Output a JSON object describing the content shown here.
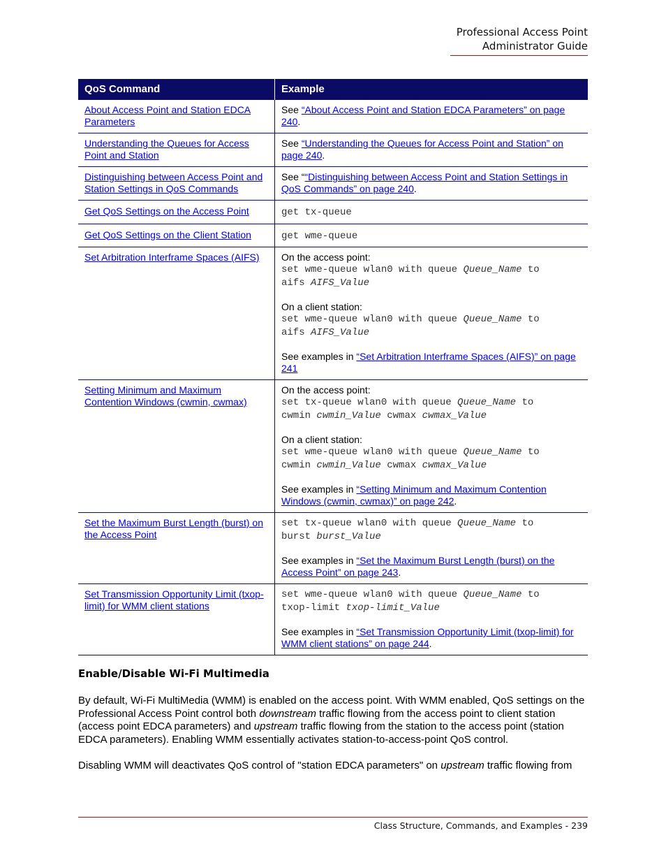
{
  "header": {
    "line1": "Professional Access Point",
    "line2": "Administrator Guide"
  },
  "table": {
    "columns": [
      "QoS Command",
      "Example"
    ],
    "rows": [
      {
        "command": "About Access Point and Station EDCA Parameters",
        "see_prefix": "See ",
        "see_link": "“About Access Point and Station EDCA Parameters” on page 240",
        "see_suffix": "."
      },
      {
        "command": "Understanding the Queues for Access Point and Station",
        "see_prefix": "See ",
        "see_link": "“Understanding the Queues for Access Point and Station” on page 240",
        "see_suffix": "."
      },
      {
        "command": "Distinguishing between Access Point and Station Settings in QoS Commands",
        "see_prefix": "See “",
        "see_link": "“Distinguishing between Access Point and Station Settings in QoS Commands” on page 240",
        "see_suffix": "."
      },
      {
        "command": "Get QoS Settings on the Access Point",
        "code": "get tx-queue"
      },
      {
        "command": "Get QoS Settings on the Client Station",
        "code": "get wme-queue"
      },
      {
        "command": "Set Arbitration Interframe Spaces (AIFS)",
        "ap_label": "On the access point:",
        "ap_code_1a": "set wme-queue wlan0 with queue ",
        "ap_code_1b": "Queue_Name",
        "ap_code_1c": " to",
        "ap_code_2a": "aifs ",
        "ap_code_2b": "AIFS_Value",
        "cs_label": "On a client station:",
        "cs_code_1a": "set wme-queue wlan0 with queue ",
        "cs_code_1b": "Queue_Name",
        "cs_code_1c": " to",
        "cs_code_2a": "aifs ",
        "cs_code_2b": "AIFS_Value",
        "see_prefix": "See examples in ",
        "see_link": "“Set Arbitration Interframe Spaces (AIFS)” on page 241",
        "see_suffix": ""
      },
      {
        "command": "Setting Minimum and Maximum Contention Windows (cwmin, cwmax)",
        "ap_label": "On the access point:",
        "ap_code_1a": "set tx-queue wlan0 with queue ",
        "ap_code_1b": "Queue_Name",
        "ap_code_1c": " to",
        "ap_code_2a": "cwmin ",
        "ap_code_2b": "cwmin_Value",
        "ap_code_2c": " cwmax ",
        "ap_code_2d": "cwmax_Value",
        "cs_label": "On a client station:",
        "cs_code_1a": "set wme-queue wlan0 with queue ",
        "cs_code_1b": "Queue_Name",
        "cs_code_1c": " to",
        "cs_code_2a": "cwmin ",
        "cs_code_2b": "cwmin_Value",
        "cs_code_2c": " cwmax ",
        "cs_code_2d": "cwmax_Value",
        "see_prefix": "See examples in ",
        "see_link": "“Setting Minimum and Maximum Contention Windows (cwmin, cwmax)” on page 242",
        "see_suffix": "."
      },
      {
        "command": "Set the Maximum Burst Length (burst) on the Access Point",
        "code_1a": "set tx-queue wlan0 with queue ",
        "code_1b": "Queue_Name",
        "code_1c": " to",
        "code_2a": "burst ",
        "code_2b": "burst_Value",
        "see_prefix": "See examples in ",
        "see_link": "“Set the Maximum Burst Length (burst) on the Access Point” on page 243",
        "see_suffix": "."
      },
      {
        "command": "Set Transmission Opportunity Limit (txop-limit) for WMM client stations",
        "code_1a": "set wme-queue wlan0 with queue ",
        "code_1b": "Queue_Name",
        "code_1c": " to",
        "code_2a": "txop-limit ",
        "code_2b": "txop-limit_Value",
        "see_prefix": "See examples in ",
        "see_link": "“Set Transmission Opportunity Limit (txop-limit) for WMM client stations” on page 244",
        "see_suffix": "."
      }
    ]
  },
  "section": {
    "title": "Enable/Disable Wi-Fi Multimedia",
    "p1_a": "By default, Wi-Fi MultiMedia (WMM) is enabled on the access point. With WMM enabled, QoS settings on the Professional Access Point control both ",
    "p1_em1": "downstream",
    "p1_b": " traffic flowing from the access point to client station (access point EDCA parameters) and ",
    "p1_em2": "upstream",
    "p1_c": " traffic flowing from the station to the access point (station EDCA parameters). Enabling WMM essentially activates station-to-access-point QoS control.",
    "p2_a": "Disabling WMM will deactivates QoS control of \"station EDCA parameters\" on ",
    "p2_em": "upstream",
    "p2_b": " traffic flowing from"
  },
  "footer": {
    "text": "Class Structure, Commands, and Examples - 239"
  },
  "colors": {
    "table_header_bg": "#0b0b66",
    "link": "#0000ee",
    "rule": "#dd0000"
  }
}
